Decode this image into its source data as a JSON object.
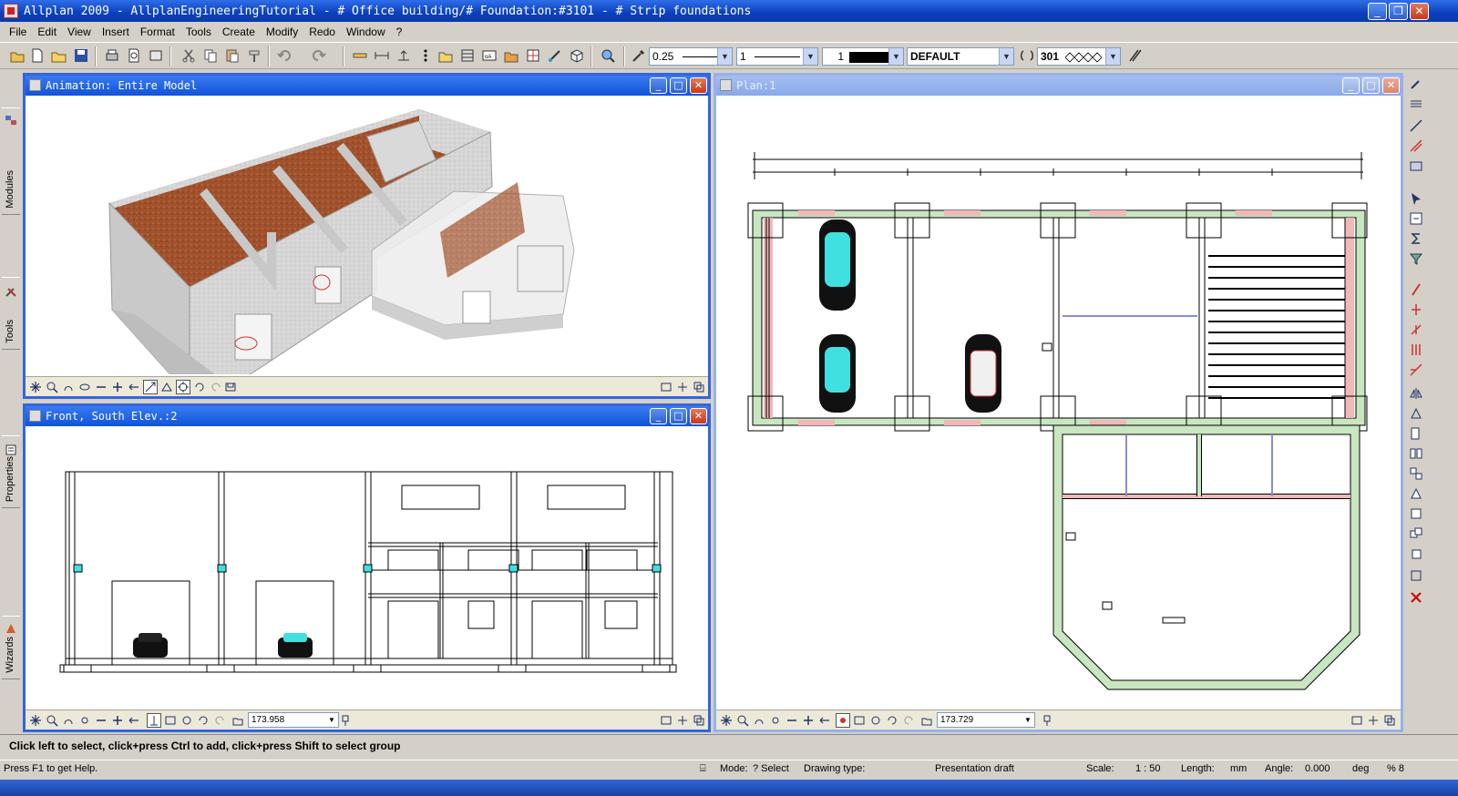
{
  "app": {
    "title": "Allplan 2009 - AllplanEngineeringTutorial - # Office building/# Foundation:#3101 - # Strip foundations",
    "controls": {
      "minimize": "_",
      "restore": "❐",
      "close": "✕"
    }
  },
  "menu": [
    "File",
    "Edit",
    "View",
    "Insert",
    "Format",
    "Tools",
    "Create",
    "Modify",
    "Redo",
    "Window",
    "?"
  ],
  "toolbar": {
    "pen_thickness": "0.25",
    "line_type": "1",
    "color": "1",
    "layer": "DEFAULT",
    "pattern": "301"
  },
  "left_tabs": [
    "Modules",
    "Tools",
    "Properties",
    "Wizards"
  ],
  "windows": {
    "animation": {
      "title": "Animation: Entire Model"
    },
    "elevation": {
      "title": "Front, South Elev.:2",
      "zoom": "173.958"
    },
    "plan": {
      "title": "Plan:1",
      "zoom": "173.729"
    }
  },
  "colors": {
    "title_blue": "#0a3fbf",
    "wall_grey": "#d8d8d8",
    "brick": "#a0522d",
    "foundation_green": "#c8e6c0",
    "column_pink": "#f0b8b8",
    "car_cyan": "#40e0e0"
  },
  "prompt": "Click left to select, click+press Ctrl to add, click+press Shift to select group",
  "status": {
    "help": "Press F1 to get Help.",
    "mode_label": "Mode:",
    "mode_value": "? Select",
    "drawing_type_label": "Drawing type:",
    "drawing_type_value": "Presentation draft",
    "scale_label": "Scale:",
    "scale_value": "1 : 50",
    "length_label": "Length:",
    "length_unit": "mm",
    "angle_label": "Angle:",
    "angle_value": "0.000",
    "angle_unit": "deg",
    "percent": "% 8"
  }
}
